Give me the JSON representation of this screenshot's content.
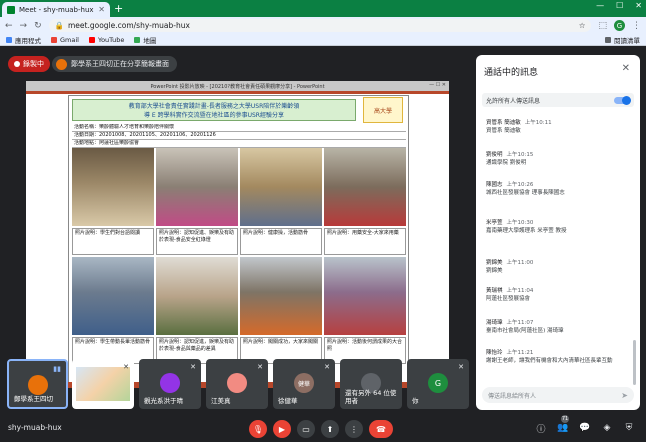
{
  "browser": {
    "tab_title": "Meet - shy-muab-hux",
    "url": "meet.google.com/shy-muab-hux",
    "profile_initial": "G",
    "bookmarks": [
      "應用程式",
      "Gmail",
      "YouTube",
      "地圖"
    ],
    "reading_list": "閱讀清單"
  },
  "slide_window_title": "PowerPoint 投影片放映 - [20210?教育社會責任碩果觀摩分享] - PowerPoint",
  "meet": {
    "recording_label": "錄製中",
    "presenting_label": "鄭學系王四切正在分享簡報畫面",
    "meeting_code": "shy-muab-hux"
  },
  "slide": {
    "header_lines": [
      "教育部大學社會責任實踐計畫-長者服務之大學USR陪伴於樂齡領",
      "導 E 跨學科實作交流暨在地社區的參事USR經驗分享"
    ],
    "logo_text": "高大學",
    "info": [
      "活動名稱：樂齡體驗人才培育和樂齡陪伴關懷",
      "活動日期：20201008、20201105、20201106、20201126",
      "活動地點：阿蓮社區樂齡協會"
    ],
    "captions": [
      "照片說明：學生們對台語閱讀",
      "照片說明：認知促進、娛樂及有助於表現-食品安全紅綠燈",
      "照片說明：健康操，活動筋骨",
      "照片說明：用藥安全-大家來用藥",
      "照片說明：學生帶動長輩活動筋骨",
      "照片說明：認知促進，娛樂及有助於表現-食品與藥品的差異",
      "照片說明：闖關成功，大家來闖關",
      "照片說明：活動後何謂成果的大合照"
    ]
  },
  "participants": [
    {
      "name": "鄭學系王四切",
      "initial": "",
      "color": "#e8710a",
      "active": true
    },
    {
      "name": "",
      "initial": "",
      "color": "#ffffff",
      "active": false
    },
    {
      "name": "觀光系洪于晴",
      "initial": "",
      "color": "#9334e6",
      "active": false
    },
    {
      "name": "江美真",
      "initial": "",
      "color": "#f28b82",
      "active": false
    },
    {
      "name": "徐健華",
      "initial": "健華",
      "color": "#8d6e63",
      "active": false
    },
    {
      "name": "還有另外 64 位使用者",
      "initial": "",
      "color": "#5f6368",
      "active": false
    },
    {
      "name": "你",
      "initial": "G",
      "color": "#1e8e3e",
      "active": false
    }
  ],
  "people_count": "71",
  "chat": {
    "title": "通話中的訊息",
    "allow_label": "允許所有人傳送訊息",
    "input_placeholder": "傳送訊息給所有人",
    "messages": [
      {
        "sender": "資管系 簡迪敏",
        "time": "上午10:11",
        "text": "資管系 簡迪敏"
      },
      {
        "sender": "劉俊明",
        "time": "上午10:15",
        "text": "通識學院 劉俊明"
      },
      {
        "sender": "陳國志",
        "time": "上午10:26",
        "text": "城西社區發展協會 理事長陳國志"
      },
      {
        "sender": "米亭萱",
        "time": "上午10:30",
        "text": "嘉南藥理大學護理系 米亭萱 教授"
      },
      {
        "sender": "劉錦美",
        "time": "上午11:00",
        "text": "劉錦美"
      },
      {
        "sender": "黃瑞祺",
        "time": "上午11:04",
        "text": "阿蓮社區發展協會"
      },
      {
        "sender": "湯琦瑋",
        "time": "上午11:07",
        "text": "臺南市社會局(阿蓮社區) 湯琦瑋"
      },
      {
        "sender": "陳怡玲",
        "time": "上午11:21",
        "text": "謝謝王老師，讓我們有機會和大內清華社區長輩互動"
      }
    ]
  }
}
